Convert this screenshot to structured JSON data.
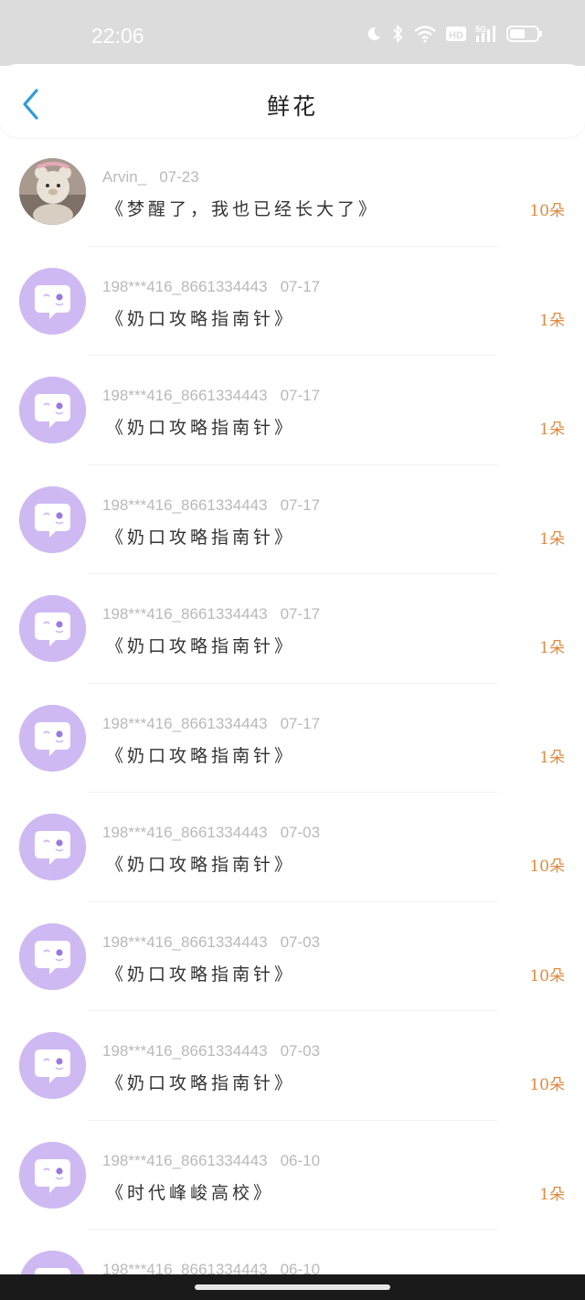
{
  "status_bar": {
    "time": "22:06",
    "icons": [
      "moon-icon",
      "bluetooth-icon",
      "wifi-icon",
      "hd-icon",
      "5g-signal-icon",
      "battery-icon"
    ],
    "hd_label": "HD",
    "network_label": "5G"
  },
  "header": {
    "title": "鲜花",
    "back_icon": "chevron-left-icon",
    "accent_color": "#2d9cdb"
  },
  "colors": {
    "count": "#e2893e",
    "avatar": "#cfb9f3"
  },
  "items": [
    {
      "name": "Arvin_",
      "date": "07-23",
      "title": "《梦醒了，我也已经长大了》",
      "count": "10朵",
      "avatar": "photo"
    },
    {
      "name": "198***416_8661334443",
      "date": "07-17",
      "title": "《奶口攻略指南针》",
      "count": "1朵",
      "avatar": "default"
    },
    {
      "name": "198***416_8661334443",
      "date": "07-17",
      "title": "《奶口攻略指南针》",
      "count": "1朵",
      "avatar": "default"
    },
    {
      "name": "198***416_8661334443",
      "date": "07-17",
      "title": "《奶口攻略指南针》",
      "count": "1朵",
      "avatar": "default"
    },
    {
      "name": "198***416_8661334443",
      "date": "07-17",
      "title": "《奶口攻略指南针》",
      "count": "1朵",
      "avatar": "default"
    },
    {
      "name": "198***416_8661334443",
      "date": "07-17",
      "title": "《奶口攻略指南针》",
      "count": "1朵",
      "avatar": "default"
    },
    {
      "name": "198***416_8661334443",
      "date": "07-03",
      "title": "《奶口攻略指南针》",
      "count": "10朵",
      "avatar": "default"
    },
    {
      "name": "198***416_8661334443",
      "date": "07-03",
      "title": "《奶口攻略指南针》",
      "count": "10朵",
      "avatar": "default"
    },
    {
      "name": "198***416_8661334443",
      "date": "07-03",
      "title": "《奶口攻略指南针》",
      "count": "10朵",
      "avatar": "default"
    },
    {
      "name": "198***416_8661334443",
      "date": "06-10",
      "title": "《时代峰峻高校》",
      "count": "1朵",
      "avatar": "default"
    },
    {
      "name": "198***416_8661334443",
      "date": "06-10",
      "title": "",
      "count": "",
      "avatar": "default"
    }
  ]
}
